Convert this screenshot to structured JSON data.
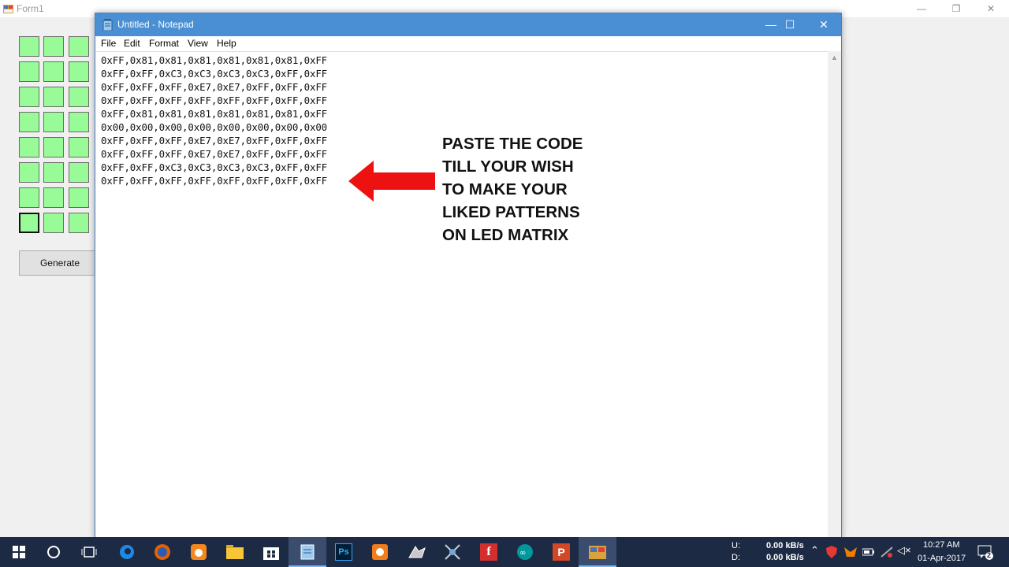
{
  "form1": {
    "title": "Form1",
    "generate_label": "Generate",
    "controls": {
      "minimize": "—",
      "restore": "❐",
      "close": "✕"
    }
  },
  "notepad": {
    "title": "Untitled - Notepad",
    "menu": [
      "File",
      "Edit",
      "Format",
      "View",
      "Help"
    ],
    "controls": {
      "minimize": "—",
      "maximize": "☐",
      "close": "✕"
    },
    "lines": [
      "0xFF,0x81,0x81,0x81,0x81,0x81,0x81,0xFF",
      "0xFF,0xFF,0xC3,0xC3,0xC3,0xC3,0xFF,0xFF",
      "0xFF,0xFF,0xFF,0xE7,0xE7,0xFF,0xFF,0xFF",
      "0xFF,0xFF,0xFF,0xFF,0xFF,0xFF,0xFF,0xFF",
      "0xFF,0x81,0x81,0x81,0x81,0x81,0x81,0xFF",
      "0x00,0x00,0x00,0x00,0x00,0x00,0x00,0x00",
      "0xFF,0xFF,0xFF,0xE7,0xE7,0xFF,0xFF,0xFF",
      "0xFF,0xFF,0xFF,0xE7,0xE7,0xFF,0xFF,0xFF",
      "0xFF,0xFF,0xC3,0xC3,0xC3,0xC3,0xFF,0xFF",
      "0xFF,0xFF,0xFF,0xFF,0xFF,0xFF,0xFF,0xFF"
    ]
  },
  "annotation": {
    "lines": [
      "PASTE THE CODE",
      "TILL YOUR WISH",
      "TO MAKE YOUR",
      "LIKED PATTERNS",
      "ON LED MATRIX"
    ],
    "arrow_color": "#ee1111"
  },
  "taskbar": {
    "apps": [
      "start-icon",
      "search-icon",
      "task-view-icon",
      "edge-icon",
      "firefox-icon",
      "uc-browser-icon",
      "file-explorer-icon",
      "store-icon",
      "notepad-icon",
      "photoshop-icon",
      "media-player-icon",
      "paint-tool-icon",
      "network-tool-icon",
      "flash-icon",
      "arduino-icon",
      "powerpoint-icon",
      "winforms-app-icon"
    ],
    "ps_label": "Ps",
    "flash_label": "f",
    "ppt_label": "P",
    "net_up_label": "U:",
    "net_down_label": "D:",
    "net_up_value": "0.00 kB/s",
    "net_down_value": "0.00 kB/s",
    "time": "10:27 AM",
    "date": "01-Apr-2017",
    "notification_count": "2"
  }
}
